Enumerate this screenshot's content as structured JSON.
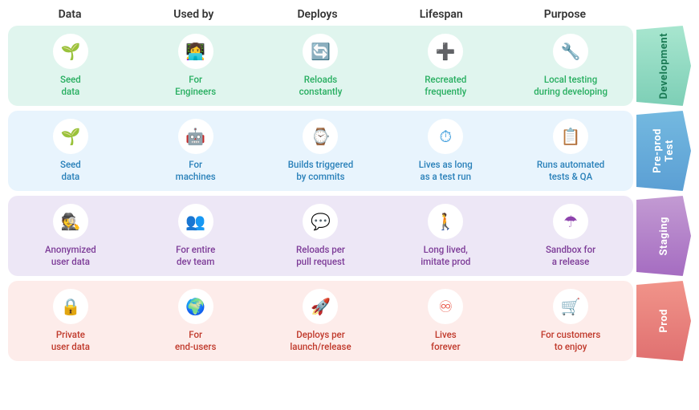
{
  "header": {
    "cols": [
      "Data",
      "Used by",
      "Deploys",
      "Lifespan",
      "Purpose"
    ]
  },
  "environments": [
    {
      "id": "development",
      "label": "Development",
      "rowClass": "dev",
      "cells": [
        {
          "icon": "🌱",
          "text": "Seed\ndata"
        },
        {
          "icon": "👩‍💻",
          "text": "For\nEngineers"
        },
        {
          "icon": "🔄",
          "text": "Reloads\nconstantly"
        },
        {
          "icon": "➕",
          "text": "Recreated\nfrequently"
        },
        {
          "icon": "🔧",
          "text": "Local testing\nduring developing"
        }
      ]
    },
    {
      "id": "test",
      "label": "Pre-prod\nTest",
      "rowClass": "test",
      "cells": [
        {
          "icon": "🌱",
          "text": "Seed\ndata"
        },
        {
          "icon": "🤖",
          "text": "For\nmachines"
        },
        {
          "icon": "⌚",
          "text": "Builds triggered\nby commits"
        },
        {
          "icon": "⏱",
          "text": "Lives as long\nas a test run"
        },
        {
          "icon": "📋",
          "text": "Runs automated\ntests & QA"
        }
      ]
    },
    {
      "id": "staging",
      "label": "Staging",
      "rowClass": "staging",
      "cells": [
        {
          "icon": "🕵️",
          "text": "Anonymized\nuser data"
        },
        {
          "icon": "👥",
          "text": "For entire\ndev team"
        },
        {
          "icon": "💬",
          "text": "Reloads per\npull request"
        },
        {
          "icon": "🚶",
          "text": "Long lived,\nimitate prod"
        },
        {
          "icon": "☂",
          "text": "Sandbox for\na release"
        }
      ]
    },
    {
      "id": "prod",
      "label": "Prod",
      "rowClass": "prod",
      "cells": [
        {
          "icon": "🔒",
          "text": "Private\nuser data"
        },
        {
          "icon": "🌍",
          "text": "For\nend-users"
        },
        {
          "icon": "🚀",
          "text": "Deploys per\nlaunch/release"
        },
        {
          "icon": "♾",
          "text": "Lives\nforever"
        },
        {
          "icon": "🛒",
          "text": "For customers\nto enjoy"
        }
      ]
    }
  ]
}
